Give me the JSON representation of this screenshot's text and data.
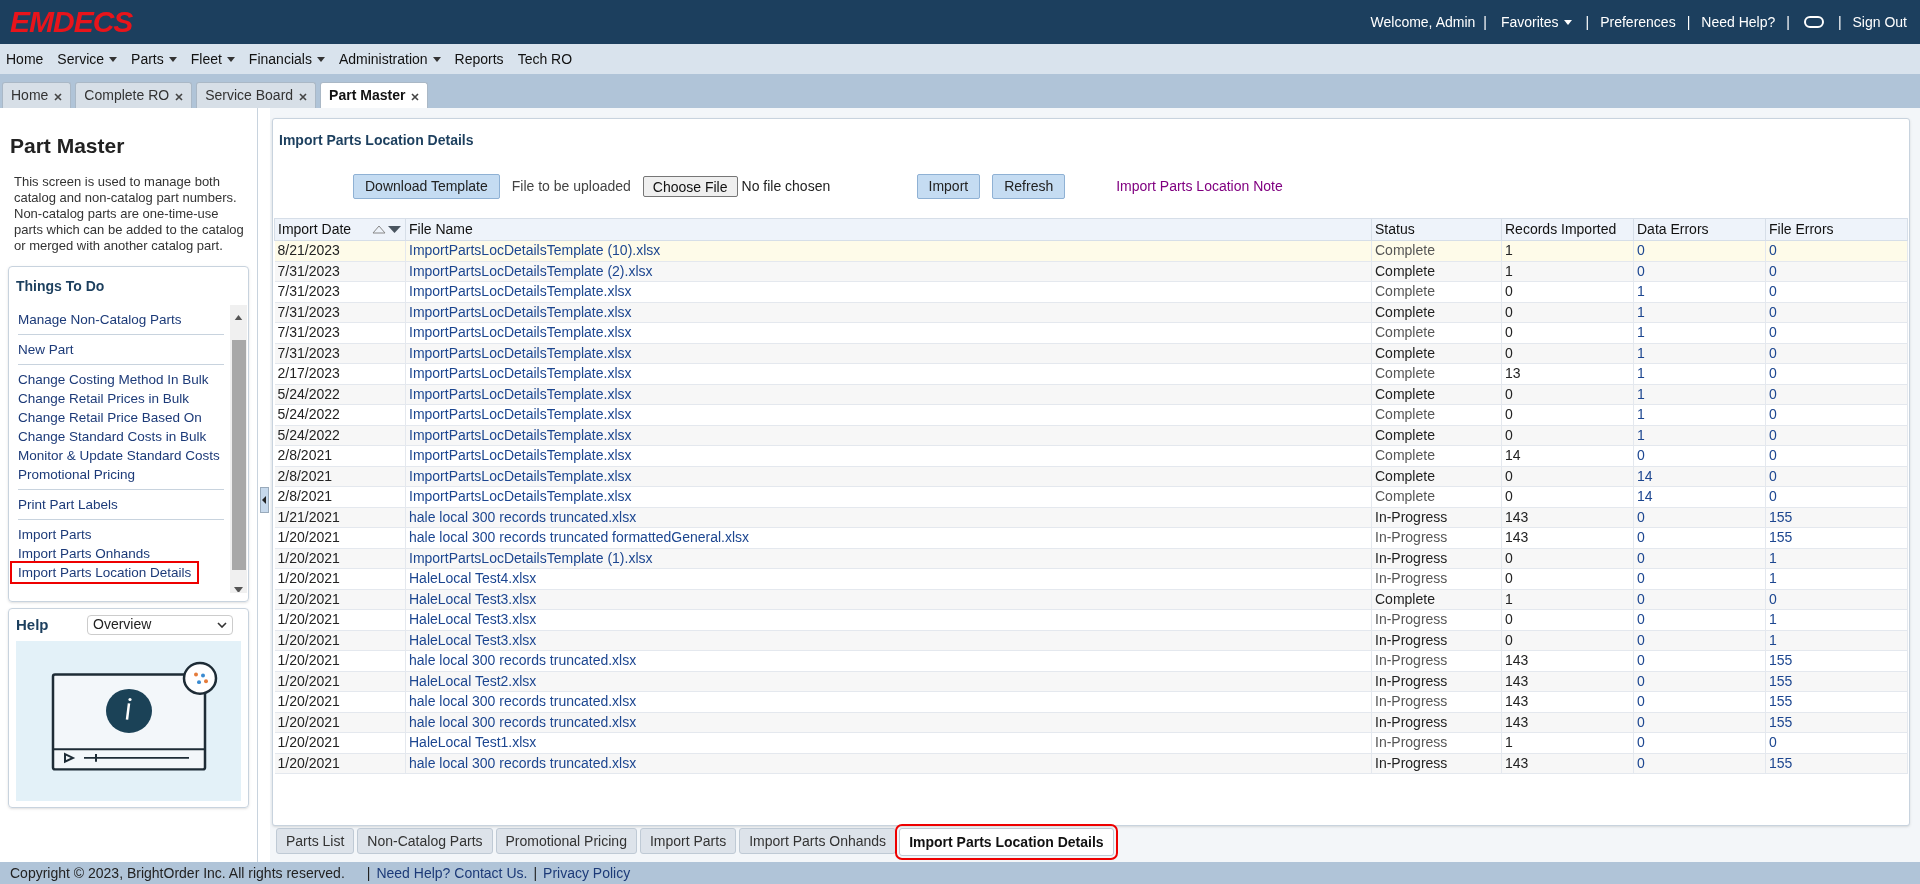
{
  "logo": "EMDECS",
  "header_links": [
    {
      "label": "Welcome, Admin",
      "kind": "text"
    },
    {
      "label": "|",
      "kind": "separator"
    },
    {
      "label": "Favorites",
      "kind": "dropdown"
    },
    {
      "label": "|",
      "kind": "separator"
    },
    {
      "label": "Preferences",
      "kind": "link"
    },
    {
      "label": "|",
      "kind": "separator"
    },
    {
      "label": "Need Help?",
      "kind": "link"
    },
    {
      "label": "|",
      "kind": "separator"
    },
    {
      "kind": "toggle"
    },
    {
      "label": "|",
      "kind": "separator"
    },
    {
      "label": "Sign Out",
      "kind": "link"
    }
  ],
  "menu": [
    {
      "label": "Home",
      "dropdown": false
    },
    {
      "label": "Service",
      "dropdown": true
    },
    {
      "label": "Parts",
      "dropdown": true
    },
    {
      "label": "Fleet",
      "dropdown": true
    },
    {
      "label": "Financials",
      "dropdown": true
    },
    {
      "label": "Administration",
      "dropdown": true
    },
    {
      "label": "Reports",
      "dropdown": false
    },
    {
      "label": "Tech RO",
      "dropdown": false
    }
  ],
  "tabs": [
    {
      "label": "Home",
      "selected": false
    },
    {
      "label": "Complete RO",
      "selected": false
    },
    {
      "label": "Service Board",
      "selected": false
    },
    {
      "label": "Part Master",
      "selected": true
    }
  ],
  "sidebar": {
    "title": "Part Master",
    "description": "This screen is used to manage both catalog and non-catalog part numbers. Non-catalog parts are one-time-use parts which can be added to the catalog or merged with another catalog part.",
    "things_to_do": {
      "title": "Things To Do",
      "groups": [
        [
          {
            "label": "Manage Non-Catalog Parts",
            "highlighted": false
          }
        ],
        [
          {
            "label": "New Part",
            "highlighted": false
          }
        ],
        [
          {
            "label": "Change Costing Method In Bulk",
            "highlighted": false
          },
          {
            "label": "Change Retail Prices in Bulk",
            "highlighted": false
          },
          {
            "label": "Change Retail Price Based On",
            "highlighted": false
          },
          {
            "label": "Change Standard Costs in Bulk",
            "highlighted": false
          },
          {
            "label": "Monitor & Update Standard Costs",
            "highlighted": false
          },
          {
            "label": "Promotional Pricing",
            "highlighted": false
          }
        ],
        [
          {
            "label": "Print Part Labels",
            "highlighted": false
          }
        ],
        [
          {
            "label": "Import Parts",
            "highlighted": false
          },
          {
            "label": "Import Parts Onhands",
            "highlighted": false
          },
          {
            "label": "Import Parts Location Details",
            "highlighted": true
          }
        ]
      ]
    },
    "help": {
      "title": "Help",
      "select_value": "Overview"
    }
  },
  "content": {
    "title": "Import Parts Location Details",
    "download_button": "Download Template",
    "upload_label": "File to be uploaded",
    "choose_file_button": "Choose File",
    "file_status": "No file chosen",
    "import_button": "Import",
    "refresh_button": "Refresh",
    "note_link": "Import Parts Location Note",
    "table": {
      "columns": [
        "Import Date",
        "File Name",
        "Status",
        "Records Imported",
        "Data Errors",
        "File Errors"
      ],
      "rows": [
        {
          "date": "8/21/2023",
          "file": "ImportPartsLocDetailsTemplate (10).xlsx",
          "status": "Complete",
          "records": "1",
          "data_errors": "0",
          "file_errors": "0",
          "selected": true
        },
        {
          "date": "7/31/2023",
          "file": "ImportPartsLocDetailsTemplate (2).xlsx",
          "status": "Complete",
          "records": "1",
          "data_errors": "0",
          "file_errors": "0",
          "selected": false
        },
        {
          "date": "7/31/2023",
          "file": "ImportPartsLocDetailsTemplate.xlsx",
          "status": "Complete",
          "records": "0",
          "data_errors": "1",
          "file_errors": "0",
          "selected": false
        },
        {
          "date": "7/31/2023",
          "file": "ImportPartsLocDetailsTemplate.xlsx",
          "status": "Complete",
          "records": "0",
          "data_errors": "1",
          "file_errors": "0",
          "selected": false
        },
        {
          "date": "7/31/2023",
          "file": "ImportPartsLocDetailsTemplate.xlsx",
          "status": "Complete",
          "records": "0",
          "data_errors": "1",
          "file_errors": "0",
          "selected": false
        },
        {
          "date": "7/31/2023",
          "file": "ImportPartsLocDetailsTemplate.xlsx",
          "status": "Complete",
          "records": "0",
          "data_errors": "1",
          "file_errors": "0",
          "selected": false
        },
        {
          "date": "2/17/2023",
          "file": "ImportPartsLocDetailsTemplate.xlsx",
          "status": "Complete",
          "records": "13",
          "data_errors": "1",
          "file_errors": "0",
          "selected": false
        },
        {
          "date": "5/24/2022",
          "file": "ImportPartsLocDetailsTemplate.xlsx",
          "status": "Complete",
          "records": "0",
          "data_errors": "1",
          "file_errors": "0",
          "selected": false
        },
        {
          "date": "5/24/2022",
          "file": "ImportPartsLocDetailsTemplate.xlsx",
          "status": "Complete",
          "records": "0",
          "data_errors": "1",
          "file_errors": "0",
          "selected": false
        },
        {
          "date": "5/24/2022",
          "file": "ImportPartsLocDetailsTemplate.xlsx",
          "status": "Complete",
          "records": "0",
          "data_errors": "1",
          "file_errors": "0",
          "selected": false
        },
        {
          "date": "2/8/2021",
          "file": "ImportPartsLocDetailsTemplate.xlsx",
          "status": "Complete",
          "records": "14",
          "data_errors": "0",
          "file_errors": "0",
          "selected": false
        },
        {
          "date": "2/8/2021",
          "file": "ImportPartsLocDetailsTemplate.xlsx",
          "status": "Complete",
          "records": "0",
          "data_errors": "14",
          "file_errors": "0",
          "selected": false
        },
        {
          "date": "2/8/2021",
          "file": "ImportPartsLocDetailsTemplate.xlsx",
          "status": "Complete",
          "records": "0",
          "data_errors": "14",
          "file_errors": "0",
          "selected": false
        },
        {
          "date": "1/21/2021",
          "file": "hale local 300 records truncated.xlsx",
          "status": "In-Progress",
          "records": "143",
          "data_errors": "0",
          "file_errors": "155",
          "selected": false
        },
        {
          "date": "1/20/2021",
          "file": "hale local 300 records truncated formattedGeneral.xlsx",
          "status": "In-Progress",
          "records": "143",
          "data_errors": "0",
          "file_errors": "155",
          "selected": false
        },
        {
          "date": "1/20/2021",
          "file": "ImportPartsLocDetailsTemplate (1).xlsx",
          "status": "In-Progress",
          "records": "0",
          "data_errors": "0",
          "file_errors": "1",
          "selected": false
        },
        {
          "date": "1/20/2021",
          "file": "HaleLocal Test4.xlsx",
          "status": "In-Progress",
          "records": "0",
          "data_errors": "0",
          "file_errors": "1",
          "selected": false
        },
        {
          "date": "1/20/2021",
          "file": "HaleLocal Test3.xlsx",
          "status": "Complete",
          "records": "1",
          "data_errors": "0",
          "file_errors": "0",
          "selected": false
        },
        {
          "date": "1/20/2021",
          "file": "HaleLocal Test3.xlsx",
          "status": "In-Progress",
          "records": "0",
          "data_errors": "0",
          "file_errors": "1",
          "selected": false
        },
        {
          "date": "1/20/2021",
          "file": "HaleLocal Test3.xlsx",
          "status": "In-Progress",
          "records": "0",
          "data_errors": "0",
          "file_errors": "1",
          "selected": false
        },
        {
          "date": "1/20/2021",
          "file": "hale local 300 records truncated.xlsx",
          "status": "In-Progress",
          "records": "143",
          "data_errors": "0",
          "file_errors": "155",
          "selected": false
        },
        {
          "date": "1/20/2021",
          "file": "HaleLocal Test2.xlsx",
          "status": "In-Progress",
          "records": "143",
          "data_errors": "0",
          "file_errors": "155",
          "selected": false
        },
        {
          "date": "1/20/2021",
          "file": "hale local 300 records truncated.xlsx",
          "status": "In-Progress",
          "records": "143",
          "data_errors": "0",
          "file_errors": "155",
          "selected": false
        },
        {
          "date": "1/20/2021",
          "file": "hale local 300 records truncated.xlsx",
          "status": "In-Progress",
          "records": "143",
          "data_errors": "0",
          "file_errors": "155",
          "selected": false
        },
        {
          "date": "1/20/2021",
          "file": "HaleLocal Test1.xlsx",
          "status": "In-Progress",
          "records": "1",
          "data_errors": "0",
          "file_errors": "0",
          "selected": false
        },
        {
          "date": "1/20/2021",
          "file": "hale local 300 records truncated.xlsx",
          "status": "In-Progress",
          "records": "143",
          "data_errors": "0",
          "file_errors": "155",
          "selected": false
        }
      ]
    }
  },
  "bottom_tabs": [
    {
      "label": "Parts List",
      "selected": false
    },
    {
      "label": "Non-Catalog Parts",
      "selected": false
    },
    {
      "label": "Promotional Pricing",
      "selected": false
    },
    {
      "label": "Import Parts",
      "selected": false
    },
    {
      "label": "Import Parts Onhands",
      "selected": false
    },
    {
      "label": "Import Parts Location Details",
      "selected": true
    }
  ],
  "footer": {
    "copyright": "Copyright © 2023, BrightOrder Inc. All rights reserved.",
    "links": [
      {
        "label": "|",
        "kind": "separator"
      },
      {
        "label": "Need Help? Contact Us.",
        "kind": "link"
      },
      {
        "label": "|",
        "kind": "separator"
      },
      {
        "label": "Privacy Policy",
        "kind": "link"
      }
    ]
  }
}
